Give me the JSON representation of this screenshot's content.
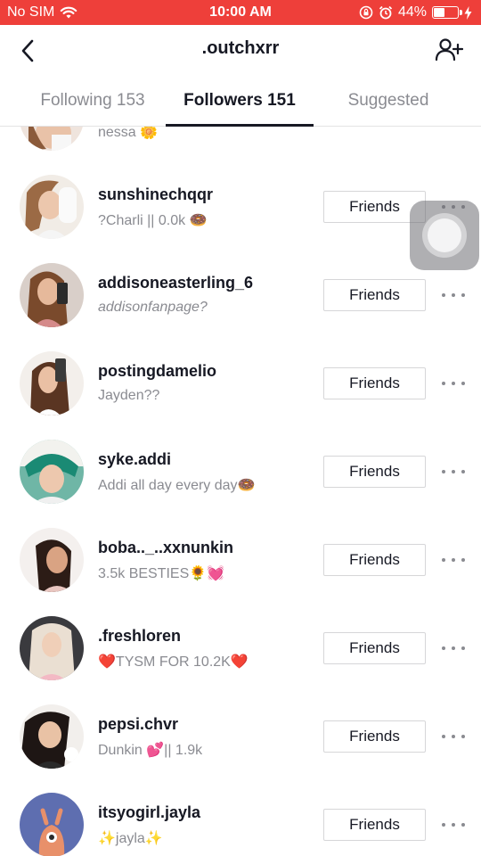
{
  "status_bar": {
    "carrier": "No SIM",
    "time": "10:00 AM",
    "battery_text": "44%",
    "battery_level": 0.44
  },
  "header": {
    "title": ".outchxrr",
    "back_icon": "chevron-left-icon",
    "add_icon": "add-user-icon"
  },
  "tabs": [
    {
      "label": "Following 153",
      "active": false
    },
    {
      "label": "Followers 151",
      "active": true
    },
    {
      "label": "Suggested",
      "active": false
    }
  ],
  "colors": {
    "status_bar_bg": "#ee3f3a",
    "primary_text": "#161823",
    "secondary_text": "#8a8b91"
  },
  "followers": [
    {
      "username": "",
      "subtitle": "nessa 🌼",
      "button": "",
      "italic": false
    },
    {
      "username": "sunshinechqqr",
      "subtitle": "?Charli || 0.0k 🍩",
      "button": "Friends",
      "italic": false
    },
    {
      "username": "addisoneasterling_6",
      "subtitle": "addisonfanpage?",
      "button": "Friends",
      "italic": true
    },
    {
      "username": "postingdamelio",
      "subtitle": "Jayden??",
      "button": "Friends",
      "italic": false
    },
    {
      "username": "syke.addi",
      "subtitle": "Addi all day every day🍩",
      "button": "Friends",
      "italic": false
    },
    {
      "username": "boba.._..xxnunkin",
      "subtitle": "3.5k BESTIES🌻💓",
      "button": "Friends",
      "italic": false
    },
    {
      "username": ".freshloren",
      "subtitle": "❤️TYSM FOR 10.2K❤️",
      "button": "Friends",
      "italic": false
    },
    {
      "username": "pepsi.chvr",
      "subtitle": "Dunkin 💕|| 1.9k",
      "button": "Friends",
      "italic": false
    },
    {
      "username": "itsyogirl.jayla",
      "subtitle": "✨jayla✨",
      "button": "Friends",
      "italic": false
    }
  ]
}
